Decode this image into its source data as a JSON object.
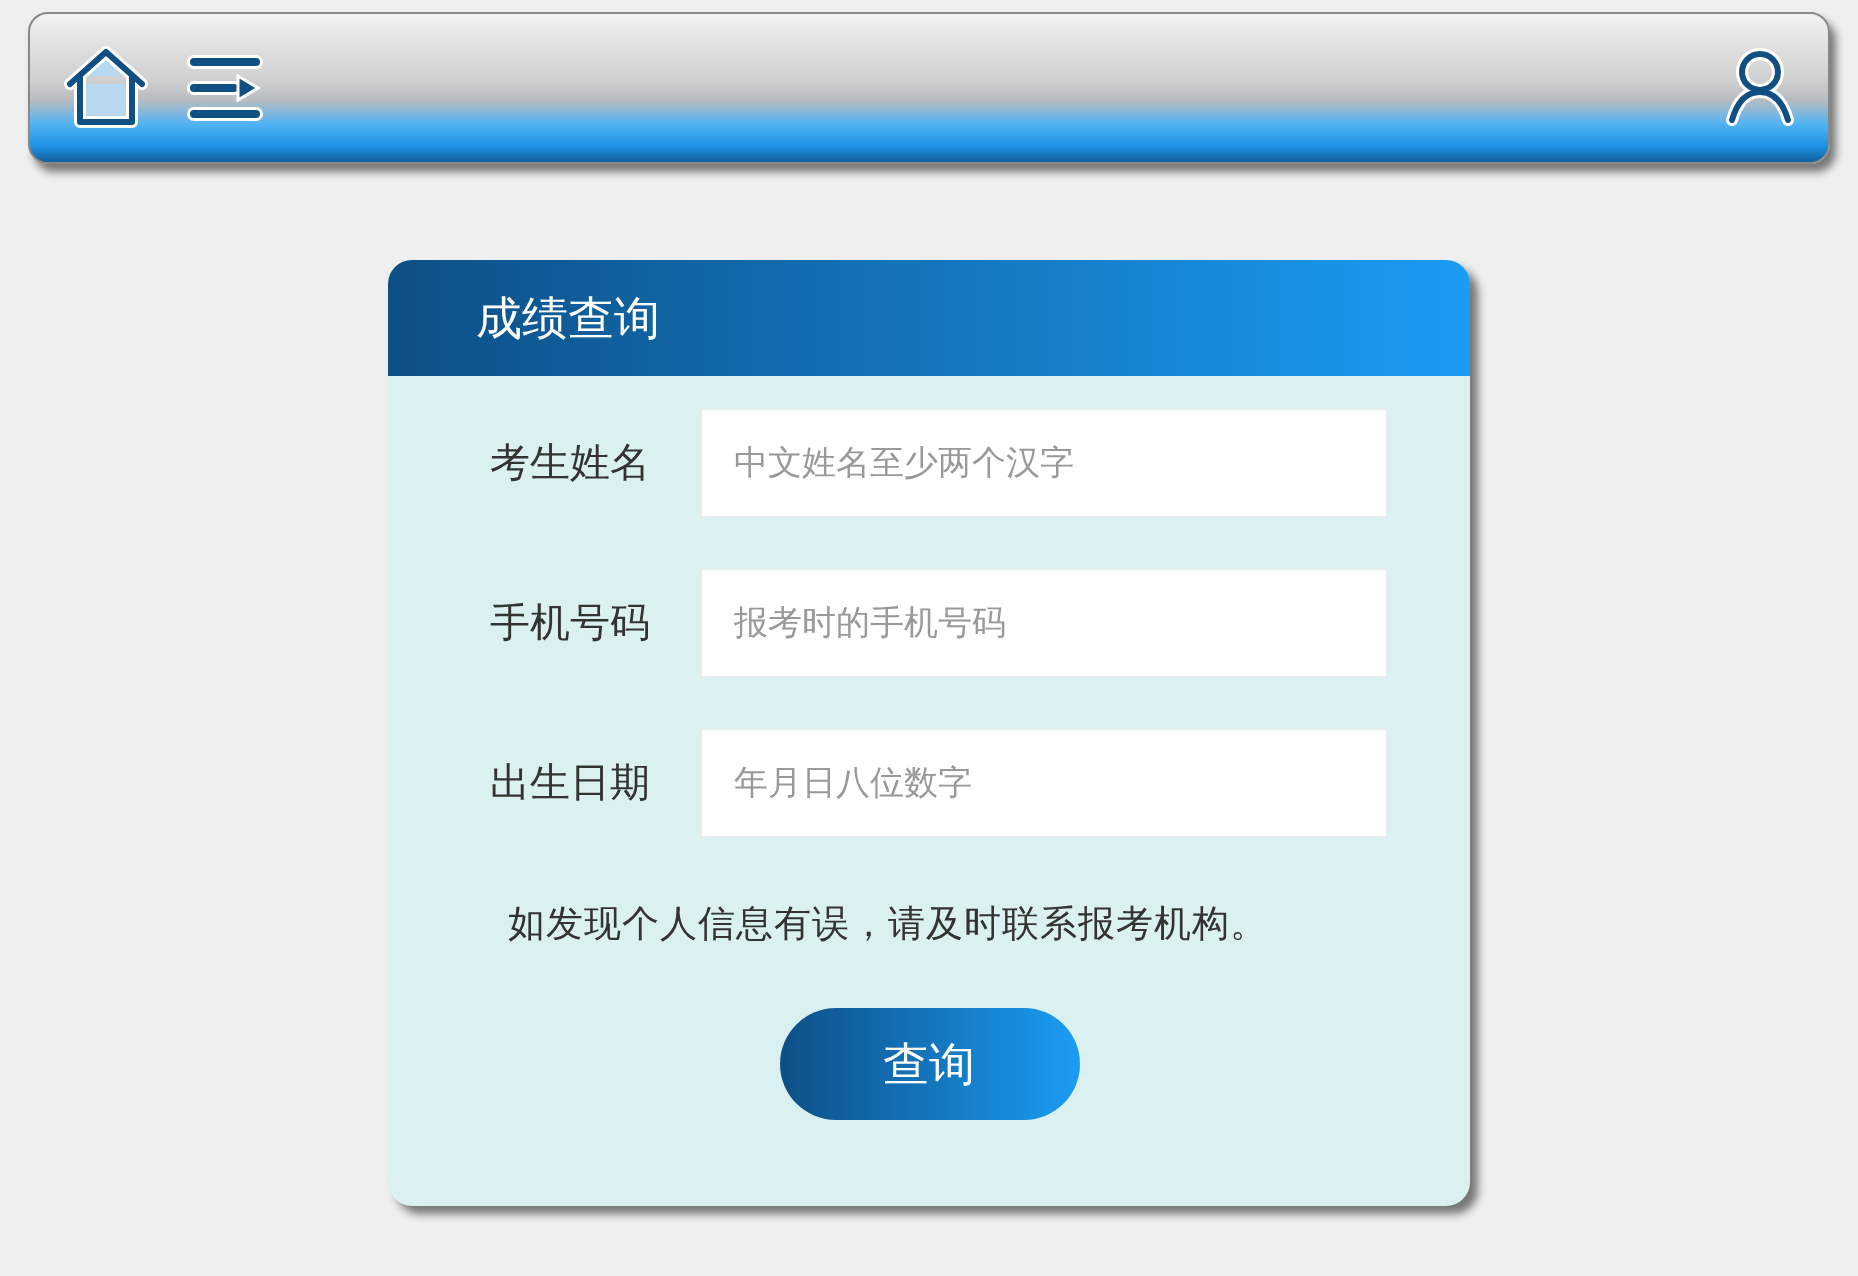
{
  "card": {
    "title": "成绩查询",
    "fields": [
      {
        "label": "考生姓名",
        "placeholder": "中文姓名至少两个汉字"
      },
      {
        "label": "手机号码",
        "placeholder": "报考时的手机号码"
      },
      {
        "label": "出生日期",
        "placeholder": "年月日八位数字"
      }
    ],
    "note": "如发现个人信息有误，请及时联系报考机构。",
    "button": "查询"
  }
}
